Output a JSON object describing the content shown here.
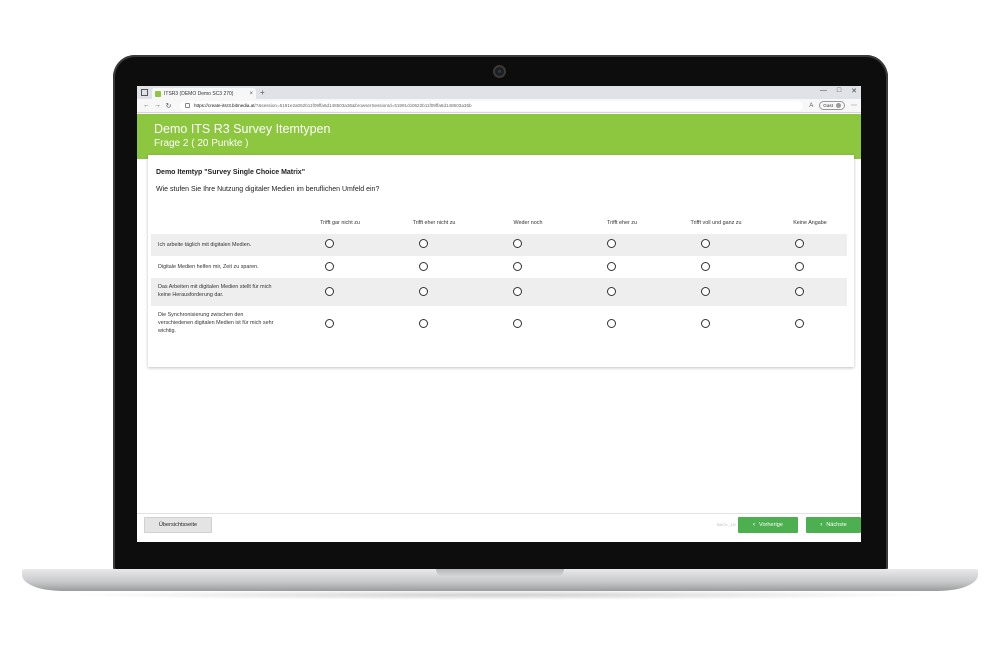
{
  "browser": {
    "tab_title": "ITSR3 (DEMO Demo SC3 270)",
    "tab_close": "×",
    "new_tab": "+",
    "window_controls": [
      "—",
      "□",
      "✕"
    ],
    "nav": {
      "back": "←",
      "forward": "→",
      "reload": "↻"
    },
    "url_host": "https://create-itsr3.bitmedia.at",
    "url_path": "/?&session=5191e2a062b11f09ffa6d148503a36&browserSessionId=51991cb0622b11f09ffa6d148503a36b",
    "reader_icon": "A",
    "profile_label": "Gast",
    "menu_icon": "⋯"
  },
  "header": {
    "title": "Demo ITS R3 Survey Itemtypen",
    "subtitle": "Frage   2 ( 20 Punkte )",
    "color": "#8dc63f"
  },
  "item": {
    "title": "Demo Itemtyp \"Survey Single Choice Matrix\"",
    "question": "Wie stufen Sie Ihre Nutzung digitaler Medien im beruflichen Umfeld ein?",
    "columns": [
      "Trifft gar nicht zu",
      "Trifft eher nicht zu",
      "Weder noch",
      "Trifft eher zu",
      "Trifft voll und ganz zu",
      "Keine Angabe"
    ],
    "rows": [
      {
        "label": "Ich arbeite täglich mit digitalen Medien."
      },
      {
        "label": "Digitale Medien helfen mir, Zeit zu sparen."
      },
      {
        "label": "Das Arbeiten mit digitalen Medien stellt für mich keine Herausforderung dar."
      },
      {
        "label": "Die Synchronisierung zwischen den verschiedenen digitalen Medien ist für mich sehr wichtig."
      }
    ]
  },
  "footer": {
    "overview_label": "Übersichtsseite",
    "note": "BACK_1/0",
    "prev_label": "Vorherige",
    "next_label": "Nächste",
    "button_color": "#4caf50"
  }
}
